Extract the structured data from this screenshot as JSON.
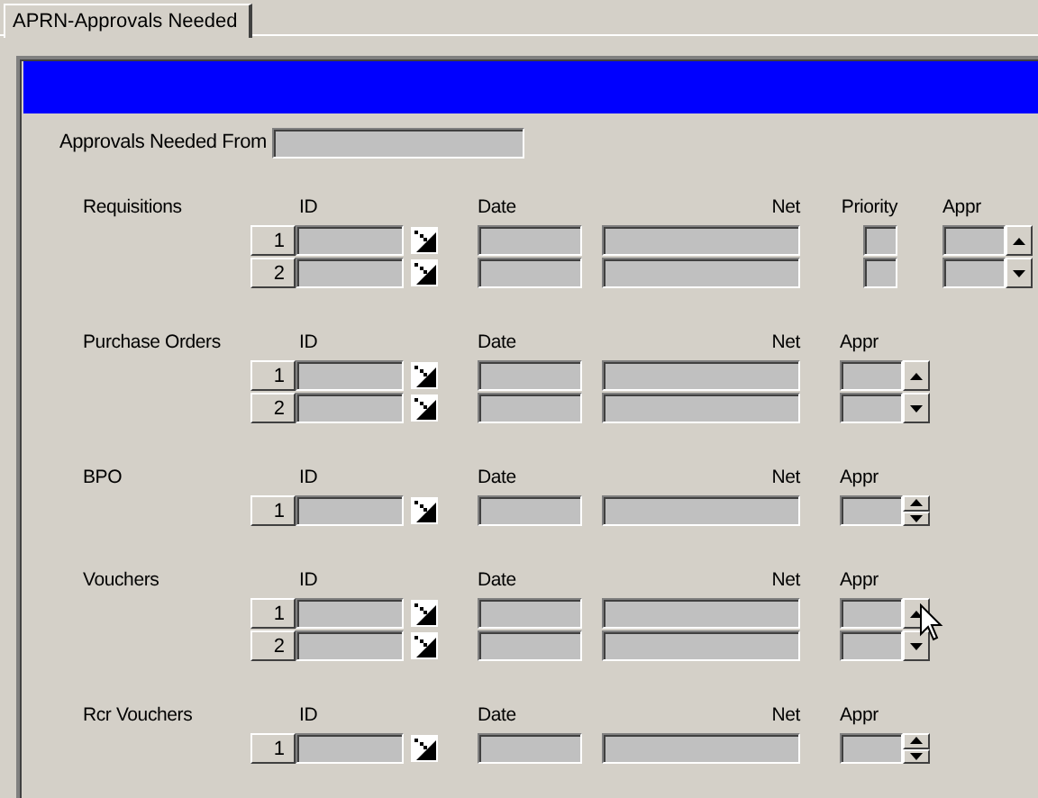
{
  "tab": {
    "label": "APRN-Approvals Needed",
    "selected": true
  },
  "approvals_from": {
    "label": "Approvals Needed From"
  },
  "sections": [
    {
      "label": "Requisitions",
      "columns": [
        {
          "kind": "id",
          "label": "ID"
        },
        {
          "kind": "date",
          "label": "Date"
        },
        {
          "kind": "net",
          "label": "Net"
        },
        {
          "kind": "priority",
          "label": "Priority"
        },
        {
          "kind": "appr",
          "label": "Appr"
        }
      ],
      "rows": [
        {
          "number": "1"
        },
        {
          "number": "2"
        }
      ]
    },
    {
      "label": "Purchase Orders",
      "columns": [
        {
          "kind": "id",
          "label": "ID"
        },
        {
          "kind": "date",
          "label": "Date"
        },
        {
          "kind": "net",
          "label": "Net"
        },
        {
          "kind": "appr",
          "label": "Appr"
        }
      ],
      "rows": [
        {
          "number": "1"
        },
        {
          "number": "2"
        }
      ]
    },
    {
      "label": "BPO",
      "columns": [
        {
          "kind": "id",
          "label": "ID"
        },
        {
          "kind": "date",
          "label": "Date"
        },
        {
          "kind": "net",
          "label": "Net"
        },
        {
          "kind": "appr",
          "label": "Appr"
        }
      ],
      "rows": [
        {
          "number": "1"
        }
      ]
    },
    {
      "label": "Vouchers",
      "columns": [
        {
          "kind": "id",
          "label": "ID"
        },
        {
          "kind": "date",
          "label": "Date"
        },
        {
          "kind": "net",
          "label": "Net"
        },
        {
          "kind": "appr",
          "label": "Appr"
        }
      ],
      "rows": [
        {
          "number": "1"
        },
        {
          "number": "2"
        }
      ]
    },
    {
      "label": "Rcr Vouchers",
      "columns": [
        {
          "kind": "id",
          "label": "ID"
        },
        {
          "kind": "date",
          "label": "Date"
        },
        {
          "kind": "net",
          "label": "Net"
        },
        {
          "kind": "appr",
          "label": "Appr"
        }
      ],
      "rows": [
        {
          "number": "1"
        }
      ]
    }
  ]
}
